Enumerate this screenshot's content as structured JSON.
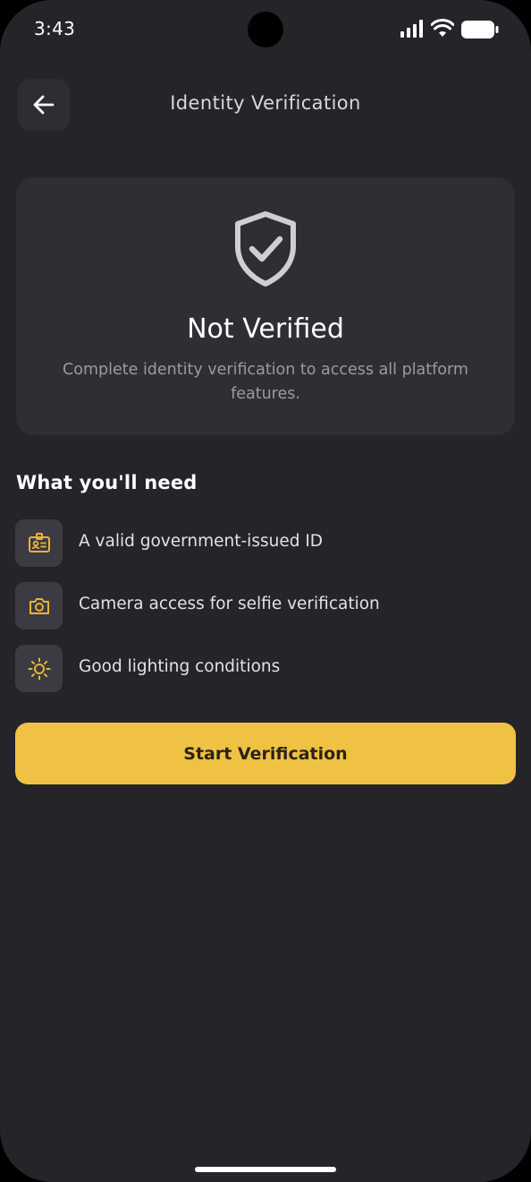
{
  "status_bar": {
    "time": "3:43"
  },
  "header": {
    "title": "Identity Verification",
    "back_icon": "arrow-left-icon"
  },
  "status_card": {
    "icon": "shield-check-icon",
    "title": "Not Verified",
    "description": "Complete identity verification to access all platform features."
  },
  "requirements": {
    "title": "What you'll need",
    "items": [
      {
        "icon": "id-card-icon",
        "label": "A valid government-issued ID"
      },
      {
        "icon": "camera-icon",
        "label": "Camera access for selfie verification"
      },
      {
        "icon": "sun-icon",
        "label": "Good lighting conditions"
      }
    ]
  },
  "cta": {
    "label": "Start Verification"
  },
  "colors": {
    "background": "#252429",
    "card": "#2f2e33",
    "accent": "#f0c244",
    "icon_accent": "#e6b53a"
  }
}
